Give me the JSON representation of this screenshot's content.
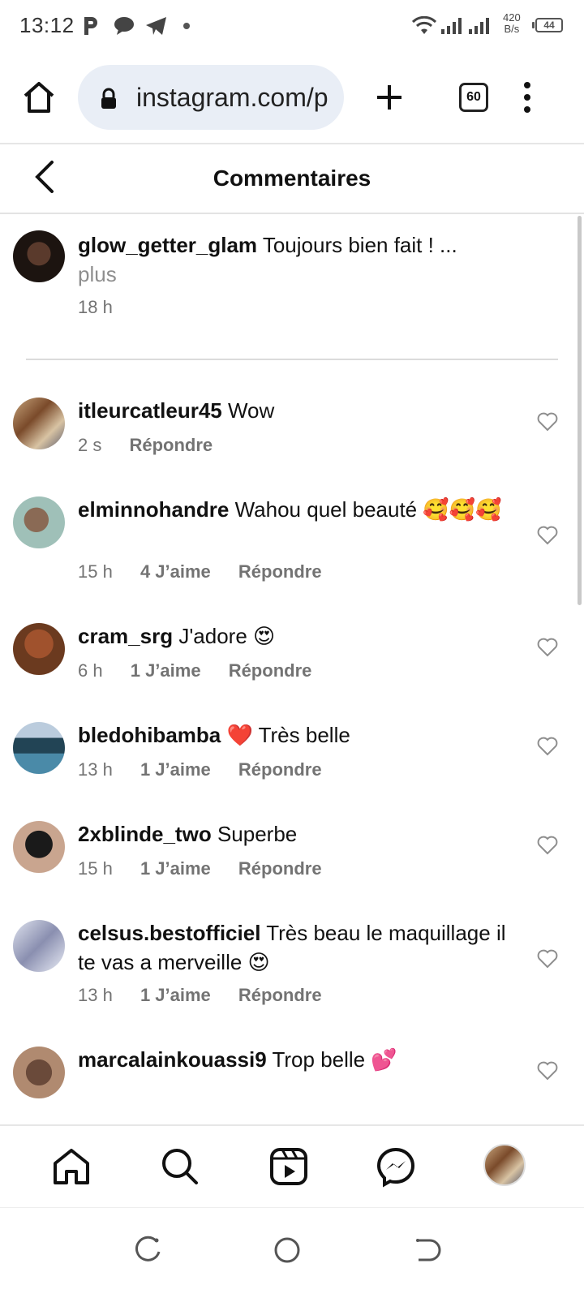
{
  "status_bar": {
    "time": "13:12",
    "net_speed_value": "420",
    "net_speed_unit": "B/s",
    "battery": "44",
    "icons": [
      "p-icon",
      "chat-icon",
      "telegram-icon",
      "dot-icon",
      "wifi-icon",
      "signal-icon",
      "signal-icon-2"
    ]
  },
  "browser": {
    "url": "instagram.com/p",
    "tab_count": "60"
  },
  "header": {
    "title": "Commentaires"
  },
  "caption": {
    "username": "glow_getter_glam",
    "text": "Toujours bien fait ! ...",
    "more_label": "plus",
    "time": "18 h"
  },
  "comments": [
    {
      "username": "itleurcatleur45",
      "text": "Wow",
      "time": "2 s",
      "likes": "",
      "reply": "Répondre"
    },
    {
      "username": "elminnohandre",
      "text": "Wahou quel beauté 🥰🥰🥰",
      "time": "15 h",
      "likes": "4 J’aime",
      "reply": "Répondre"
    },
    {
      "username": "cram_srg",
      "text": "J'adore 😍",
      "time": "6 h",
      "likes": "1 J’aime",
      "reply": "Répondre"
    },
    {
      "username": "bledohibamba",
      "text": "❤️ Très belle",
      "time": "13 h",
      "likes": "1 J’aime",
      "reply": "Répondre"
    },
    {
      "username": "2xblinde_two",
      "text": "Superbe",
      "time": "15 h",
      "likes": "1 J’aime",
      "reply": "Répondre"
    },
    {
      "username": "celsus.bestofficiel",
      "text": "Très beau le maquillage il te vas a merveille 😍",
      "time": "13 h",
      "likes": "1 J’aime",
      "reply": "Répondre"
    },
    {
      "username": "marcalainkouassi9",
      "text": "Trop belle 💕",
      "time": "",
      "likes": "",
      "reply": ""
    }
  ],
  "colors": {
    "url_pill": "#e9eef6",
    "meta_text": "#737373",
    "divider": "#dbdbdb"
  }
}
